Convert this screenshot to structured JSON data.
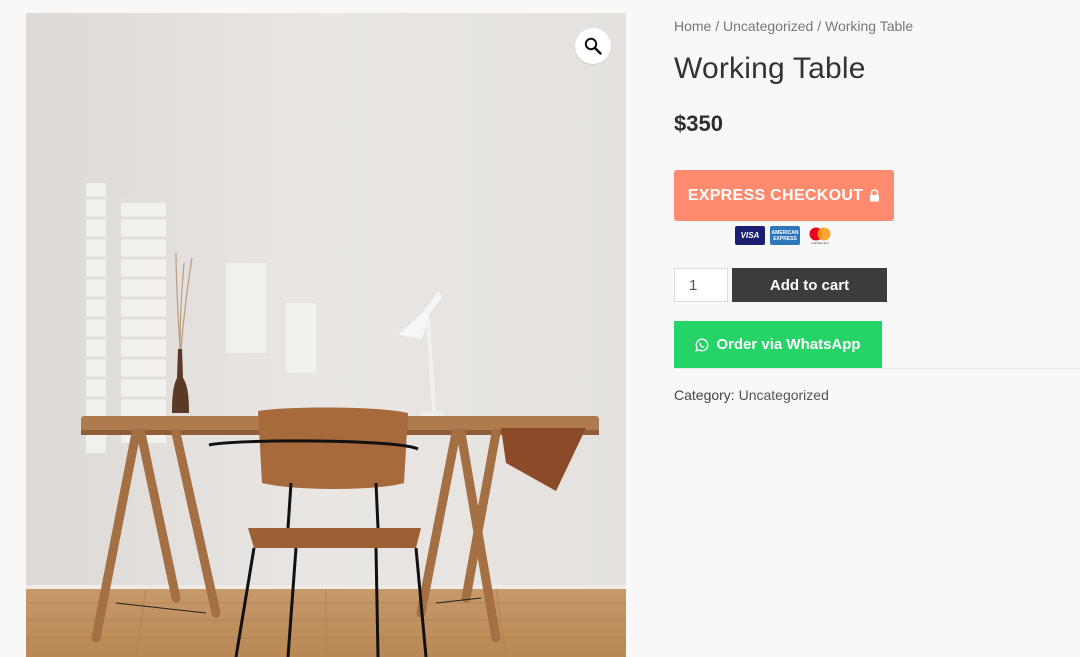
{
  "breadcrumb": {
    "home": "Home",
    "sep1": " / ",
    "category": "Uncategorized",
    "sep2": " / ",
    "current": "Working Table"
  },
  "product": {
    "title": "Working Table",
    "price": "$350",
    "image_icon": "zoom-magnifier-icon"
  },
  "express_checkout": {
    "label": "EXPRESS CHECKOUT",
    "lock_icon": "lock-icon",
    "payment_cards": [
      "VISA",
      "AMERICAN EXPRESS",
      "mastercard"
    ],
    "color": "#ff8a6e"
  },
  "cart": {
    "quantity": "1",
    "add_label": "Add to cart",
    "button_color": "#3c3c3c"
  },
  "whatsapp": {
    "label": "Order via WhatsApp",
    "icon": "whatsapp-icon",
    "color": "#25d366"
  },
  "meta": {
    "category_label": "Category:",
    "category_value": "Uncategorized"
  }
}
